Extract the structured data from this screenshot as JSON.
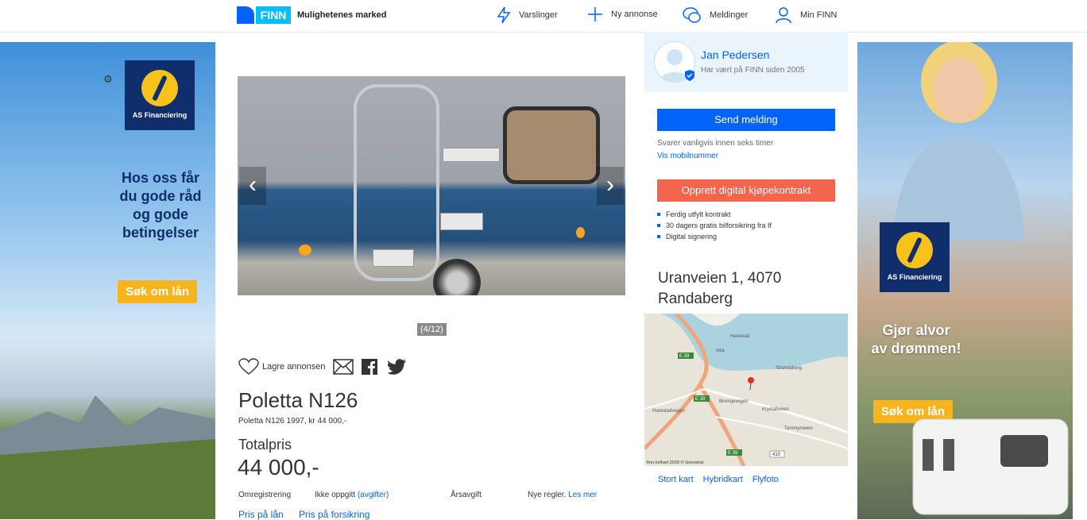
{
  "header": {
    "logo_text": "FINN",
    "slogan": "Mulighetenes marked",
    "nav": [
      {
        "label": "Varslinger",
        "icon": "bolt-icon"
      },
      {
        "label": "Ny annonse",
        "icon": "plus-icon"
      },
      {
        "label": "Meldinger",
        "icon": "chat-icon"
      },
      {
        "label": "Min FINN",
        "icon": "user-icon"
      }
    ]
  },
  "ad_left": {
    "brand": "AS Financiering",
    "headline": [
      "Hos oss får",
      "du gode råd",
      "og gode",
      "betingelser"
    ],
    "cta": "Søk om lån"
  },
  "ad_right": {
    "brand": "AS Financiering",
    "headline": [
      "Gjør alvor",
      "av drømmen!"
    ],
    "cta": "Søk om lån"
  },
  "gallery": {
    "counter": "(4/12)",
    "prev": "‹",
    "next": "›"
  },
  "actions": {
    "save_label": "Lagre annonsen"
  },
  "listing": {
    "title": "Poletta N126",
    "subtitle": "Poletta N126 1997, kr 44 000,-",
    "price_label": "Totalpris",
    "price": "44 000,-",
    "reg_label": "Omregistrering",
    "reg_value": "Ikke oppgitt",
    "reg_link": "(avgifter)",
    "annual_label": "Årsavgift",
    "annual_value": "Nye regler.",
    "annual_link": "Les mer",
    "loan_link": "Pris på lån",
    "insurance_link": "Pris på forsikring"
  },
  "seller": {
    "name": "Jan Pedersen",
    "since": "Har vært på FINN siden 2005",
    "send_button": "Send melding",
    "response": "Svarer vanligvis innen seks timer",
    "phone_link": "Vis mobilnummer",
    "contract_button": "Opprett digital kjøpekontrakt",
    "contract_points": [
      "Ferdig utfylt kontrakt",
      "30 dagers gratis bilforsikring fra If",
      "Digital signering"
    ]
  },
  "location": {
    "address_line1": "Uranveien 1, 4070",
    "address_line2": "Randaberg",
    "map_labels": [
      "Harestad",
      "vika",
      "Strandaberg",
      "E 39",
      "E 39",
      "E 39",
      "Bronsjevegen",
      "Krystallveien",
      "Torvmyrveien",
      "Harestadvegen",
      "410"
    ],
    "map_copyright": "finn.no/kart 2018 © Geovekst",
    "links": [
      "Stort kart",
      "Hybridkart",
      "Flyfoto"
    ]
  },
  "colors": {
    "primary": "#0063fb",
    "accent_red": "#f3664d",
    "seller_bg": "#eaf4fd",
    "ad_cta": "#f8b41c",
    "ad_brand": "#0f2e6b"
  }
}
